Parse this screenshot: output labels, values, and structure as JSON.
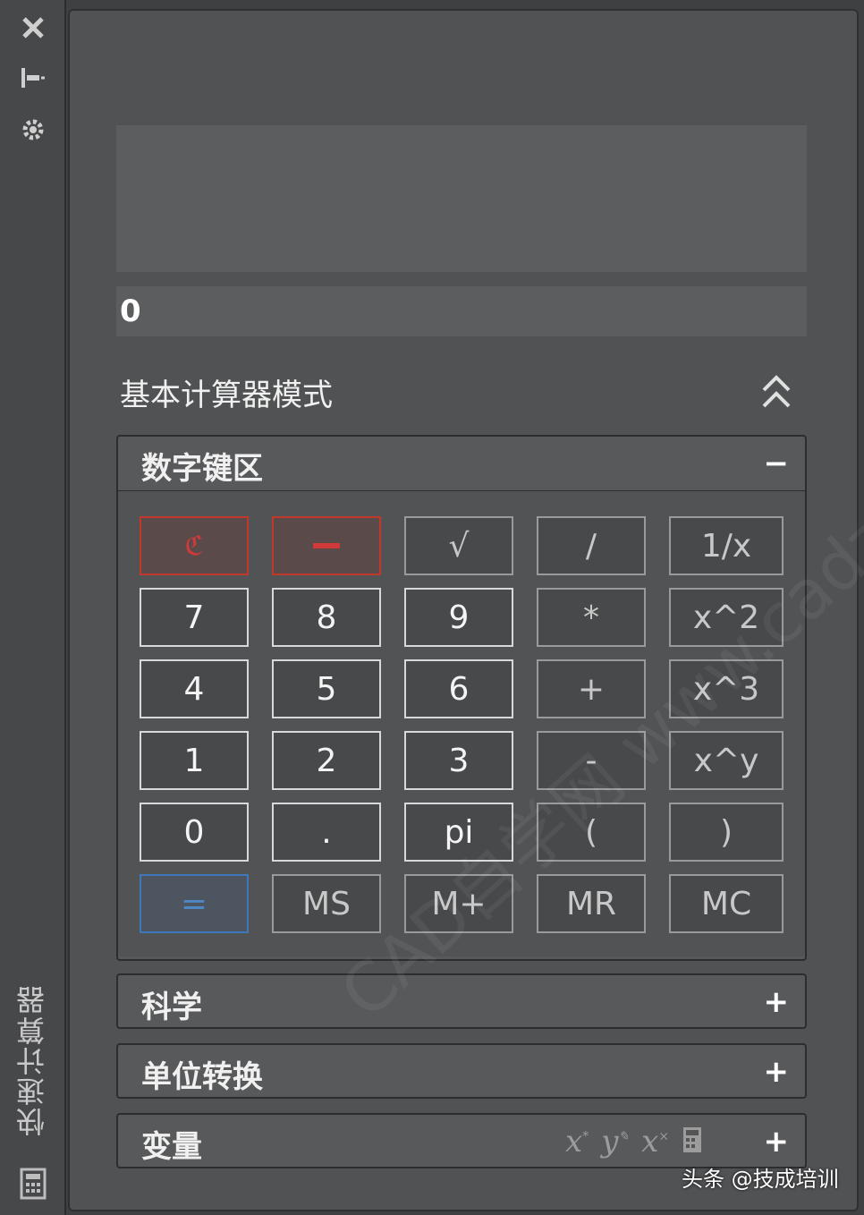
{
  "palette_title": "快速计算器",
  "display_value": "0",
  "mode_title": "基本计算器模式",
  "sections": {
    "numpad": {
      "title": "数字键区",
      "toggle": "−"
    },
    "science": {
      "title": "科学",
      "toggle": "+"
    },
    "units": {
      "title": "单位转换",
      "toggle": "+"
    },
    "variables": {
      "title": "变量",
      "toggle": "+"
    }
  },
  "keys": {
    "r1": [
      "",
      "",
      "√",
      "/",
      "1/x"
    ],
    "r2": [
      "7",
      "8",
      "9",
      "*",
      "x^2"
    ],
    "r3": [
      "4",
      "5",
      "6",
      "+",
      "x^3"
    ],
    "r4": [
      "1",
      "2",
      "3",
      "-",
      "x^y"
    ],
    "r5": [
      "0",
      ".",
      "pi",
      "(",
      ")"
    ],
    "r6": [
      "=",
      "MS",
      "M+",
      "MR",
      "MC"
    ]
  },
  "watermark": "CAD自学网 www.cadzxw.com",
  "attribution": "头条 @技成培训",
  "colors": {
    "accent_red": "#c0392b",
    "accent_blue": "#3f78b8"
  },
  "icons": [
    "close-icon",
    "pin-icon",
    "settings-icon",
    "clear-icon",
    "clear-history-icon",
    "paste-icon",
    "get-coordinates-icon",
    "distance-icon",
    "angle-icon",
    "intersection-icon",
    "help-icon",
    "calculator-icon"
  ]
}
